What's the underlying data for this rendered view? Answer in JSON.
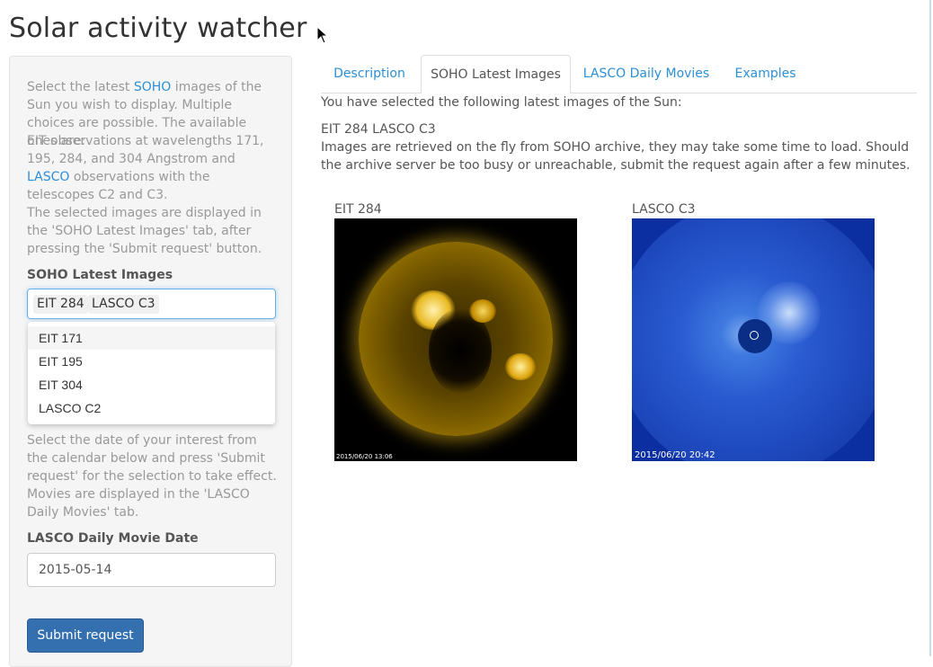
{
  "app": {
    "title": "Solar activity watcher"
  },
  "sidebar": {
    "intro_pre": "Select the latest ",
    "soho_link": "SOHO",
    "intro_post": " images of the Sun you wish to display. Multiple choices are possible. The available ones are:",
    "eit_pre": "EIT observations at wavelengths 171, 195, 284, and 304 Angstrom and ",
    "lasco_link": "LASCO",
    "eit_post": " observations with the telescopes C2 and C3.",
    "displayed_note": "The selected images are displayed in the 'SOHO Latest Images' tab, after pressing the 'Submit request' button.",
    "select_label": "SOHO Latest Images",
    "selected_chips": [
      "EIT 284",
      "LASCO C3"
    ],
    "dropdown_options": [
      "EIT 171",
      "EIT 195",
      "EIT 304",
      "LASCO C2"
    ],
    "movie_text_1": "Select the date of your interest from the calendar below and press 'Submit request' for the selection to take effect.",
    "movie_text_2": "Movies are displayed in the 'LASCO Daily Movies' tab.",
    "date_label": "LASCO Daily Movie Date",
    "date_value": "2015-05-14",
    "submit_label": "Submit request"
  },
  "tabs": [
    "Description",
    "SOHO Latest Images",
    "LASCO Daily Movies",
    "Examples"
  ],
  "main": {
    "selected_intro": "You have selected the following latest images of the Sun:",
    "selected_list": "EIT 284 LASCO C3",
    "retrieval_note": "Images are retrieved on the fly from SOHO archive, they may take some time to load. Should the archive server be too busy or unreachable, submit the request again after a few minutes.",
    "images": [
      {
        "title": "EIT 284",
        "timestamp": "2015/06/20 13:06"
      },
      {
        "title": "LASCO C3",
        "timestamp": "2015/06/20 20:42"
      }
    ]
  },
  "colors": {
    "link": "#2c8fd6",
    "button": "#3470b0",
    "eit_gold": "#f2c63a",
    "lasco_blue": "#1f4bc0"
  }
}
